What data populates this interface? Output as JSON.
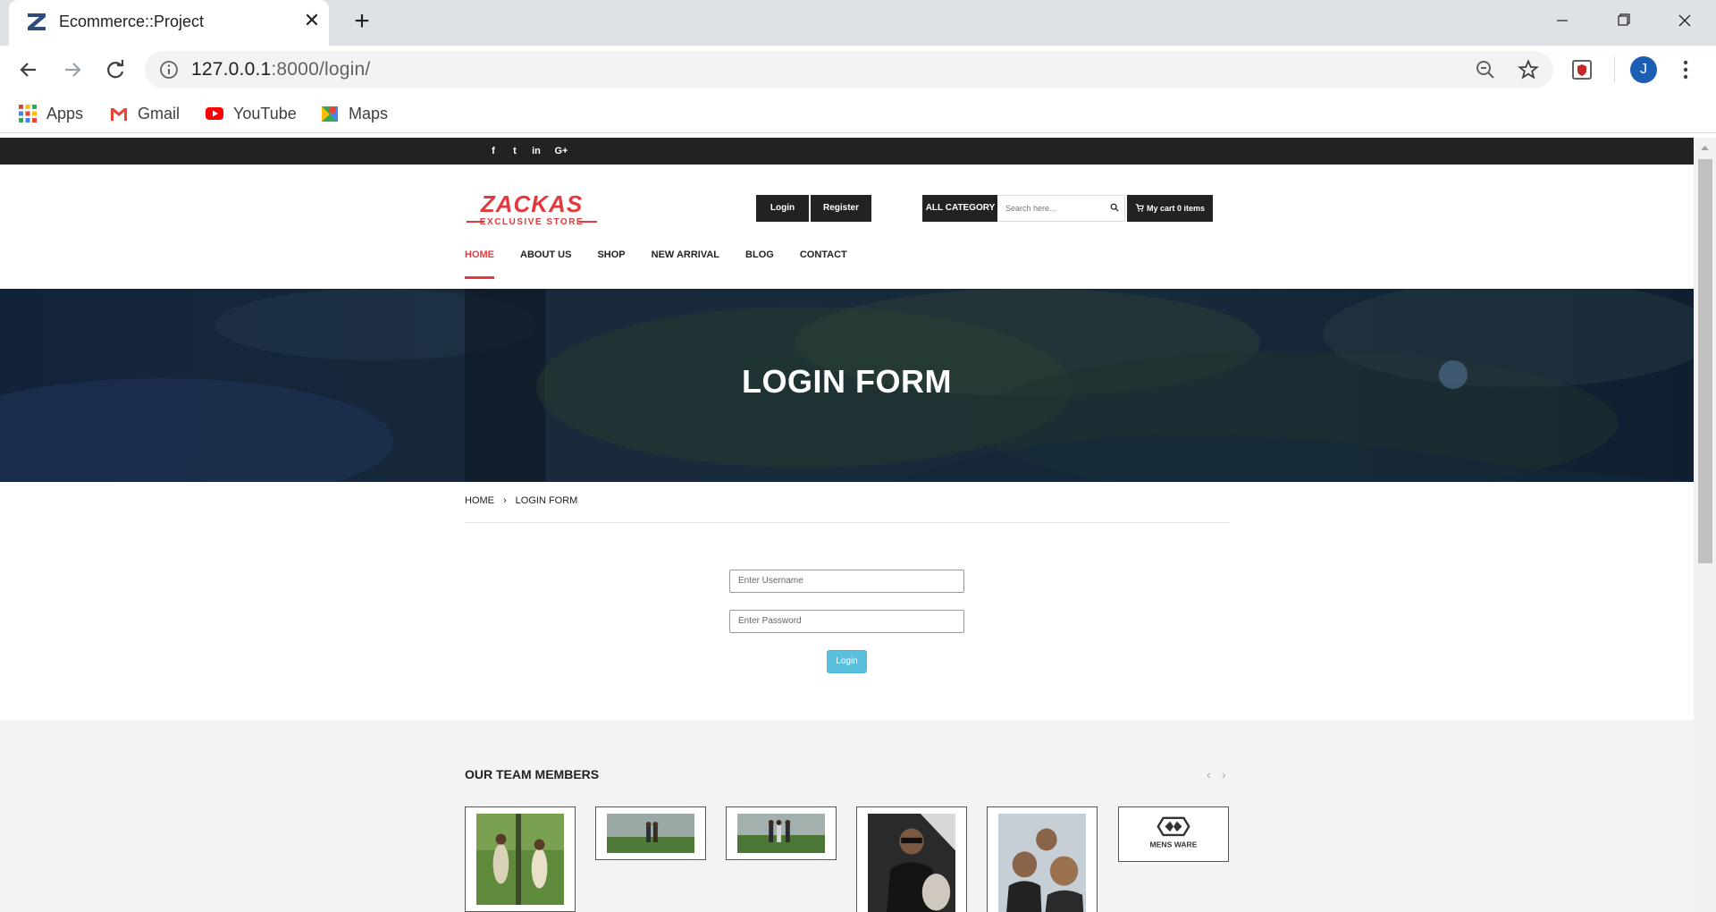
{
  "browser": {
    "tab_title": "Ecommerce::Project",
    "url_host": "127.0.0.1",
    "url_path": ":8000/login/",
    "profile_initial": "J",
    "bookmarks": [
      {
        "label": "Apps",
        "icon": "apps-grid-icon"
      },
      {
        "label": "Gmail",
        "icon": "gmail-icon"
      },
      {
        "label": "YouTube",
        "icon": "youtube-icon"
      },
      {
        "label": "Maps",
        "icon": "maps-icon"
      }
    ]
  },
  "site": {
    "social": [
      "f",
      "t",
      "in",
      "G+"
    ],
    "logo": {
      "main": "ZACKAS",
      "sub": "EXCLUSIVE STORE"
    },
    "header_buttons": {
      "login": "Login",
      "register": "Register",
      "category": "ALL CATEGORY",
      "search_placeholder": "Search here...",
      "cart": "My cart 0 items"
    },
    "menu": [
      "HOME",
      "ABOUT US",
      "SHOP",
      "NEW ARRIVAL",
      "BLOG",
      "CONTACT"
    ],
    "active_menu": "HOME",
    "banner_title": "LOGIN FORM",
    "breadcrumb": [
      "HOME",
      "›",
      "LOGIN FORM"
    ],
    "form": {
      "username_placeholder": "Enter Username",
      "password_placeholder": "Enter Password",
      "submit_label": "Login"
    },
    "team": {
      "title": "OUR TEAM MEMBERS",
      "prev": "‹",
      "next": "›",
      "last_card_logo": "MENS WARE"
    },
    "colors": {
      "accent": "#e03a3e",
      "login_button": "#5bc0de",
      "dark": "#222222"
    }
  }
}
